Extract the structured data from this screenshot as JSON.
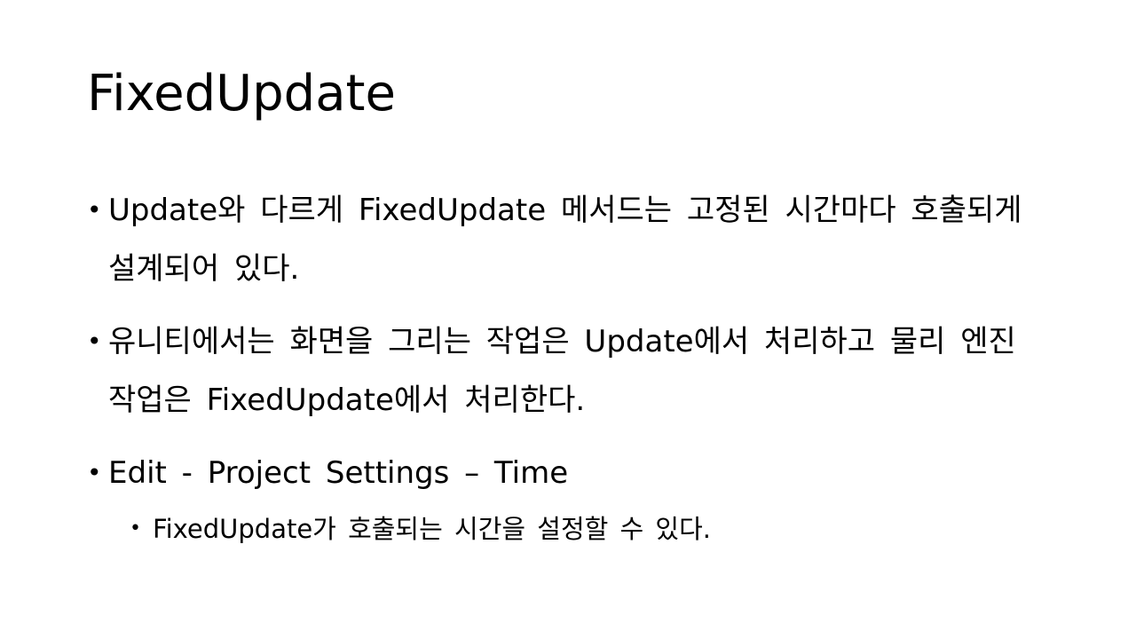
{
  "slide": {
    "title": "FixedUpdate",
    "bullet_glyph": "•",
    "bullets": [
      {
        "text": "Update와 다르게 FixedUpdate 메서드는 고정된 시간마다 호출되게 설계되어 있다."
      },
      {
        "text": "유니티에서는 화면을 그리는 작업은 Update에서 처리하고 물리 엔진 작업은 FixedUpdate에서 처리한다."
      },
      {
        "text": "Edit - Project Settings – Time",
        "sub_bullets": [
          {
            "text": "FixedUpdate가 호출되는 시간을 설정할 수 있다."
          }
        ]
      }
    ]
  }
}
